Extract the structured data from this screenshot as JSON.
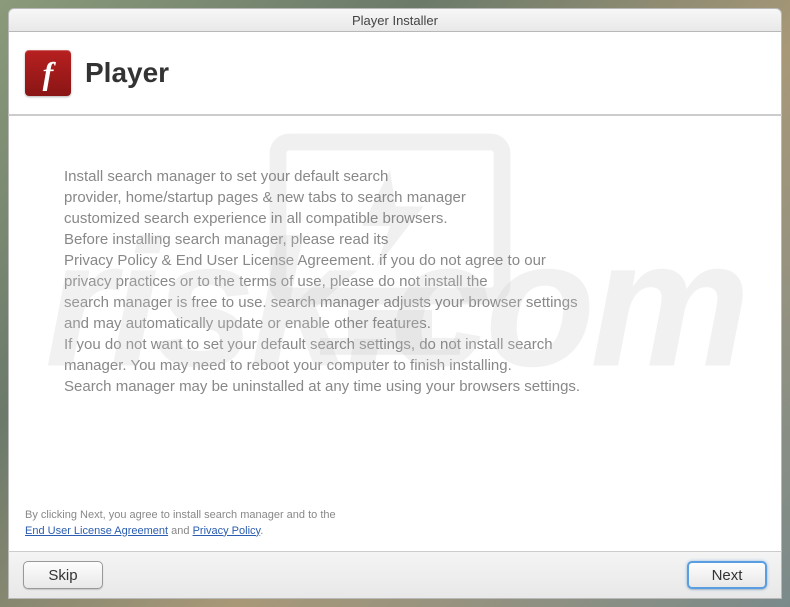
{
  "window": {
    "title": "Player Installer"
  },
  "header": {
    "icon_name": "flash-logo-icon",
    "title": "Player"
  },
  "body": {
    "lines": [
      "Install search manager to set your default search",
      "provider, home/startup pages & new tabs to search manager",
      "customized search experience in all compatible browsers.",
      "Before installing search manager, please read its",
      "Privacy Policy & End User License Agreement. if you do not agree to our",
      "privacy practices or to the terms of use, please do not install the",
      "search manager is free to use. search manager adjusts your browser settings",
      "and may automatically update or enable other features.",
      "If you do not want to set your default search settings, do not install search",
      "manager. You may need to reboot your computer to finish installing.",
      "Search manager may be uninstalled at any time using your browsers settings."
    ]
  },
  "footer": {
    "prefix": "By clicking Next, you agree to install search manager and to the",
    "eula_label": "End User License Agreement",
    "and": " and ",
    "privacy_label": "Privacy Policy",
    "suffix": "."
  },
  "buttons": {
    "skip": "Skip",
    "next": "Next"
  },
  "watermark": {
    "text": "risk.com"
  }
}
